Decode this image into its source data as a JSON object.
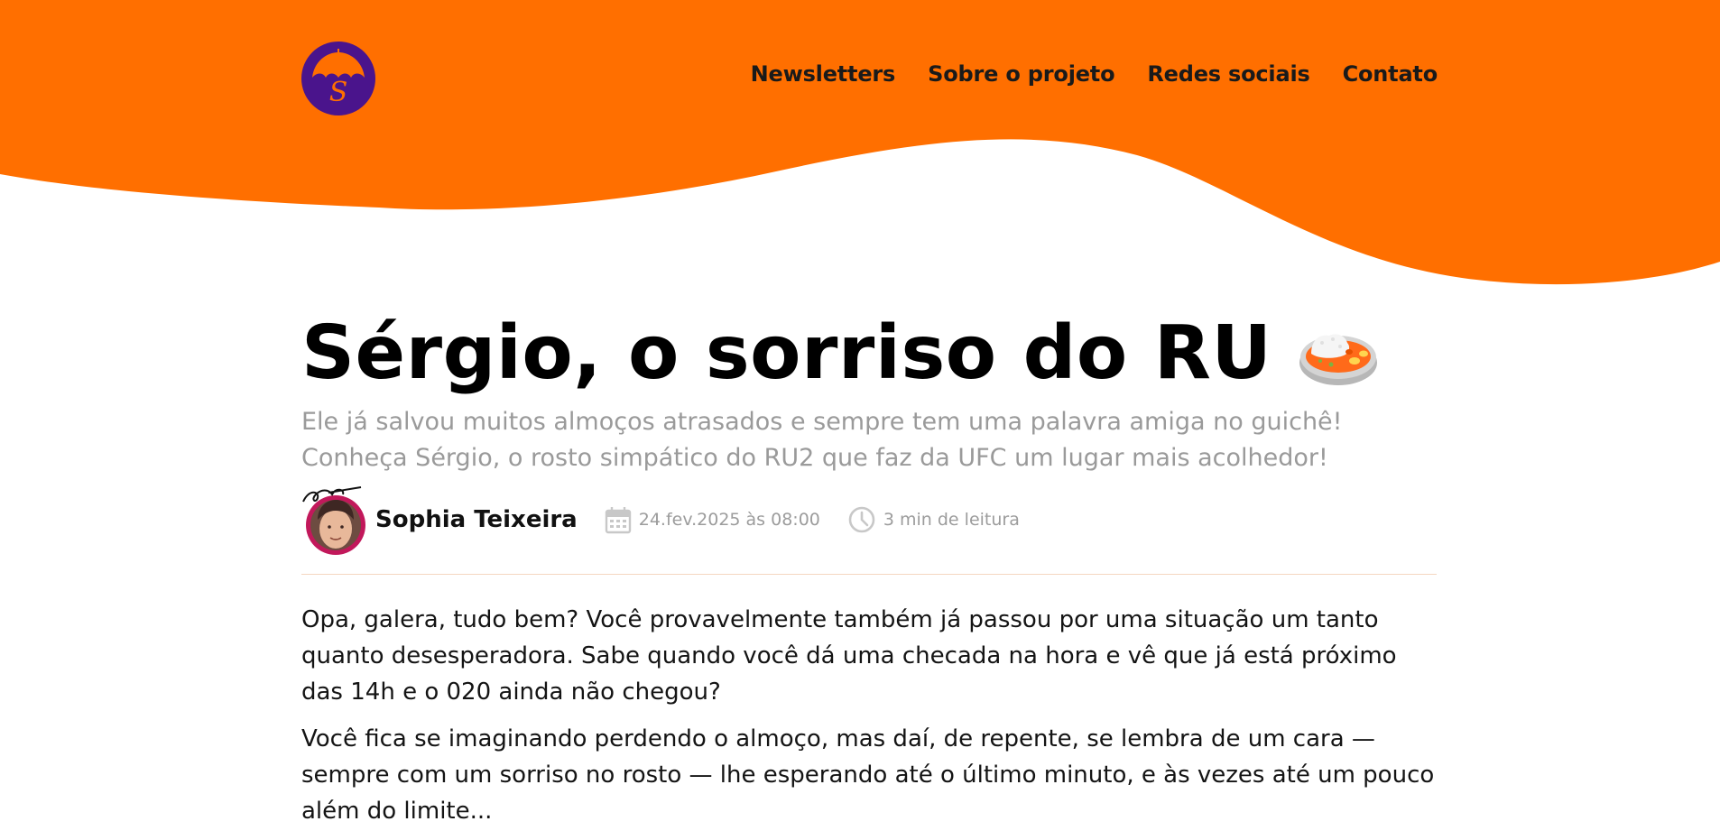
{
  "brand": {
    "logo_letter": "S",
    "primary_color": "#ff6f00",
    "logo_color": "#4a148c"
  },
  "nav": {
    "items": [
      "Newsletters",
      "Sobre o projeto",
      "Redes sociais",
      "Contato"
    ]
  },
  "article": {
    "title": "Sérgio, o sorriso do RU",
    "subtitle": "Ele já salvou muitos almoços atrasados e sempre tem uma palavra amiga no guichê! Conheça Sérgio, o rosto simpático do RU2 que faz da UFC um lugar mais acolhedor!",
    "author": "Sophia Teixeira",
    "date": "24.fev.2025 às 08:00",
    "reading_time": "3 min de leitura",
    "paragraphs": [
      "Opa, galera, tudo bem? Você provavelmente também já passou por uma situação um tanto quanto desesperadora. Sabe quando você dá uma checada na hora e vê que já está próximo das 14h e o 020 ainda não chegou?",
      "Você fica se imaginando perdendo o almoço, mas daí, de repente, se lembra de um cara — sempre com um sorriso no rosto — lhe esperando até o último minuto, e às vezes até um pouco além do limite..."
    ]
  },
  "icons": {
    "logo": "umbrella-logo-icon",
    "title_emoji": "curry-rice-icon",
    "date": "calendar-icon",
    "time": "clock-icon"
  }
}
